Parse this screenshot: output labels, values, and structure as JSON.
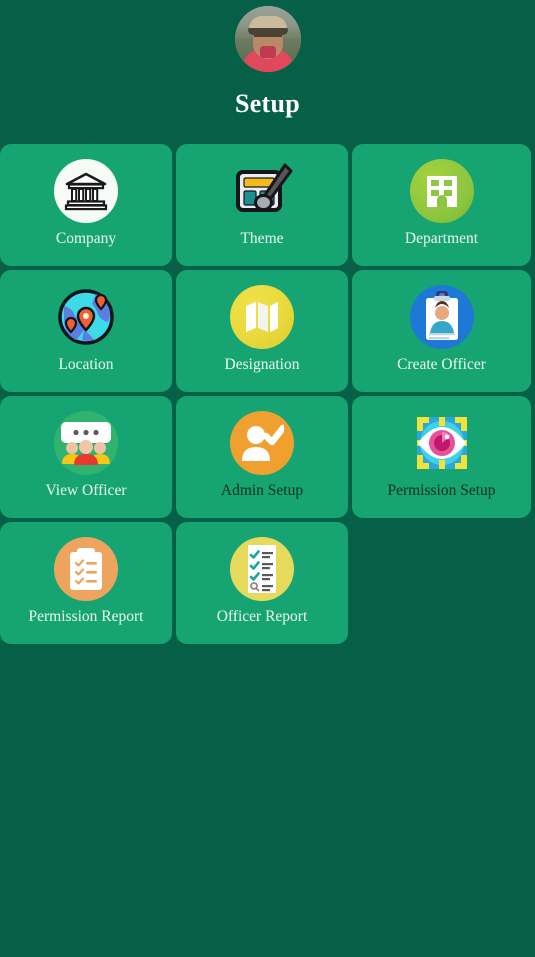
{
  "app": {
    "background_color": "#066047",
    "tile_color": "#17a473",
    "title": "Setup"
  },
  "header": {
    "avatar_name": "user-avatar",
    "title": "Setup"
  },
  "grid": {
    "tiles": [
      {
        "label": "Company",
        "icon": "bank-building-icon",
        "label_color": "light"
      },
      {
        "label": "Theme",
        "icon": "palette-brush-icon",
        "label_color": "light"
      },
      {
        "label": "Department",
        "icon": "office-building-icon",
        "label_color": "light"
      },
      {
        "label": "Location",
        "icon": "globe-pin-icon",
        "label_color": "light"
      },
      {
        "label": "Designation",
        "icon": "folded-map-icon",
        "label_color": "light"
      },
      {
        "label": "Create Officer",
        "icon": "id-badge-icon",
        "label_color": "light"
      },
      {
        "label": "View Officer",
        "icon": "people-group-icon",
        "label_color": "light"
      },
      {
        "label": "Admin Setup",
        "icon": "user-check-icon",
        "label_color": "dark"
      },
      {
        "label": "Permission Setup",
        "icon": "eye-scan-icon",
        "label_color": "dark"
      },
      {
        "label": "Permission Report",
        "icon": "clipboard-check-icon",
        "label_color": "light"
      },
      {
        "label": "Officer Report",
        "icon": "document-checklist-icon",
        "label_color": "light"
      }
    ]
  }
}
